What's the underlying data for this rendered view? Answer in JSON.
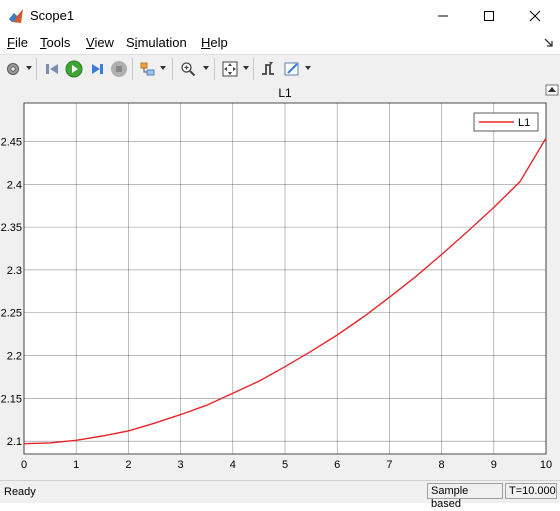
{
  "window": {
    "title": "Scope1",
    "icon": "matlab-scope-icon"
  },
  "menu": {
    "items": [
      {
        "label": "File",
        "u": "F",
        "rest": "ile"
      },
      {
        "label": "Tools",
        "u": "T",
        "rest": "ools"
      },
      {
        "label": "View",
        "u": "V",
        "rest": "iew"
      },
      {
        "label": "Simulation",
        "pre": "S",
        "u": "i",
        "rest": "mulation"
      },
      {
        "label": "Help",
        "u": "H",
        "rest": "elp"
      }
    ]
  },
  "toolbar": {
    "icons": [
      "gear-icon",
      "step-back-icon",
      "run-icon",
      "step-forward-icon",
      "stop-icon",
      "highlight-simulink-block-icon",
      "zoom-in-icon",
      "autoscale-icon",
      "trigger-icon",
      "style-icon"
    ]
  },
  "chart_data": {
    "type": "line",
    "title": "L1",
    "xlabel": "",
    "ylabel": "",
    "xlim": [
      0,
      10
    ],
    "ylim": [
      2.085,
      2.495
    ],
    "xticks": [
      0,
      1,
      2,
      3,
      4,
      5,
      6,
      7,
      8,
      9,
      10
    ],
    "yticks": [
      2.1,
      2.15,
      2.2,
      2.25,
      2.3,
      2.35,
      2.4,
      2.45
    ],
    "yticklabels": [
      "2.1",
      "2.15",
      "2.2",
      "2.25",
      "2.3",
      "2.35",
      "2.4",
      "2.45"
    ],
    "grid": true,
    "legend_position": "top-right",
    "series": [
      {
        "name": "L1",
        "color": "#e8262a",
        "x": [
          0,
          0.5,
          1,
          1.5,
          2,
          2.5,
          3,
          3.5,
          4,
          4.5,
          5,
          5.5,
          6,
          6.5,
          7,
          7.5,
          8,
          8.5,
          9,
          9.5,
          10
        ],
        "y": [
          2.097,
          2.098,
          2.101,
          2.106,
          2.112,
          2.121,
          2.131,
          2.142,
          2.156,
          2.17,
          2.187,
          2.205,
          2.224,
          2.245,
          2.268,
          2.292,
          2.318,
          2.345,
          2.373,
          2.403,
          2.454
        ]
      }
    ]
  },
  "status": {
    "text": "Ready",
    "mode": "Sample based",
    "time": "T=10.000"
  }
}
